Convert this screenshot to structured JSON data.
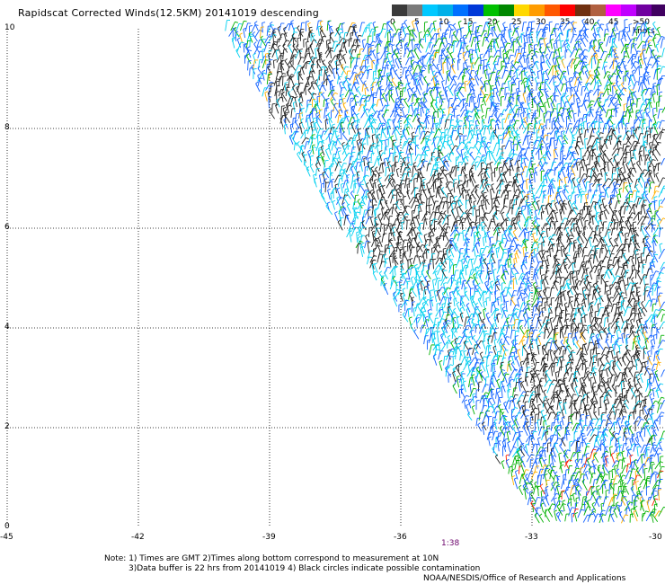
{
  "title": "Rapidscat Corrected Winds(12.5KM) 20141019 descending",
  "colorbar": {
    "colors": [
      "#3a3a3a",
      "#7a7a7a",
      "#00c8ff",
      "#00b0e8",
      "#0070ff",
      "#0038d8",
      "#00c000",
      "#008800",
      "#ffd800",
      "#ff9c00",
      "#ff5800",
      "#ff0000",
      "#703010",
      "#b06040",
      "#ff00ff",
      "#c000ff",
      "#7000a0",
      "#400060"
    ],
    "labels": [
      "0",
      "5",
      "10",
      "15",
      "20",
      "25",
      "30",
      "35",
      "40",
      "45",
      ">50 knots"
    ]
  },
  "y_axis": [
    "10",
    "8",
    "6",
    "4",
    "2",
    "0"
  ],
  "x_axis": [
    "-45",
    "-42",
    "-39",
    "-36",
    "-33",
    "-30"
  ],
  "timestamp": "1:38",
  "notes": {
    "line1": "Note: 1) Times are GMT 2)Times along bottom correspond to measurement at 10N",
    "line2": "3)Data buffer is 22 hrs from 20141019 4) Black circles indicate possible contamination"
  },
  "credit": "NOAA/NESDIS/Office of Research and Applications",
  "map": {
    "lon_range": [
      -45,
      -30
    ],
    "lat_range": [
      0,
      10
    ],
    "swath_edge": [
      [
        -40.1,
        10
      ],
      [
        -37.4,
        6
      ],
      [
        -35.0,
        3
      ],
      [
        -32.8,
        0
      ]
    ],
    "wind_colors": {
      "calm": "#222222",
      "light": "#00d0f0",
      "moderate": "#1060ff",
      "fresh": "#00b000",
      "strong": "#ffb000",
      "gale": "#ff2000"
    }
  }
}
